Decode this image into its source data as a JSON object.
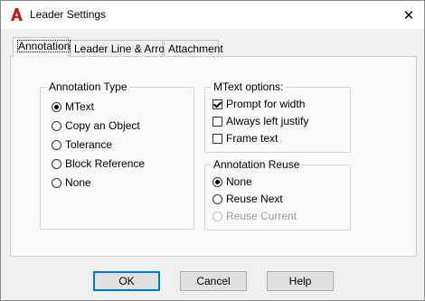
{
  "window": {
    "title": "Leader Settings",
    "close_glyph": "✕",
    "app_icon": "autocad-icon"
  },
  "tabs": [
    {
      "label": "Annotation",
      "active": true
    },
    {
      "label": "Leader Line & Arrow",
      "active": false
    },
    {
      "label": "Attachment",
      "active": false
    }
  ],
  "annotation_type": {
    "title": "Annotation Type",
    "options": [
      {
        "label": "MText",
        "checked": true
      },
      {
        "label": "Copy an Object",
        "checked": false
      },
      {
        "label": "Tolerance",
        "checked": false
      },
      {
        "label": "Block Reference",
        "checked": false
      },
      {
        "label": "None",
        "checked": false
      }
    ]
  },
  "mtext_options": {
    "title": "MText options:",
    "checkboxes": [
      {
        "label": "Prompt for width",
        "checked": true
      },
      {
        "label": "Always left justify",
        "checked": false
      },
      {
        "label": "Frame text",
        "checked": false
      }
    ]
  },
  "annotation_reuse": {
    "title": "Annotation Reuse",
    "options": [
      {
        "label": "None",
        "checked": true,
        "disabled": false
      },
      {
        "label": "Reuse Next",
        "checked": false,
        "disabled": false
      },
      {
        "label": "Reuse Current",
        "checked": false,
        "disabled": true
      }
    ]
  },
  "buttons": {
    "ok": "OK",
    "cancel": "Cancel",
    "help": "Help"
  },
  "colors": {
    "app_icon_red": "#d0161a",
    "default_button_border": "#0078d7"
  }
}
